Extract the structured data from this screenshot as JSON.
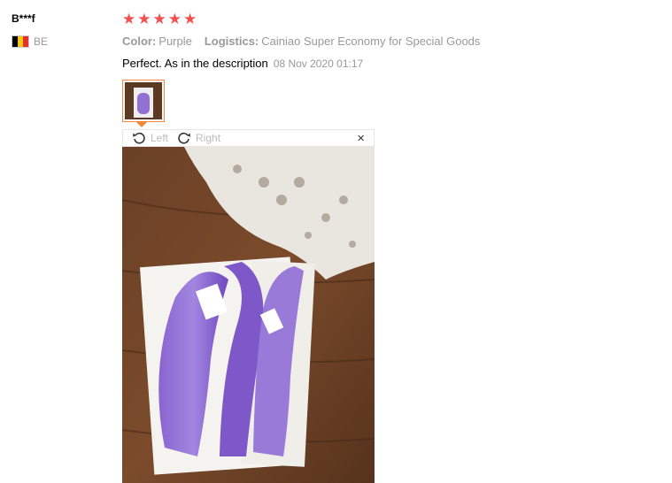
{
  "review": {
    "user": {
      "name": "B***f",
      "country_code": "BE",
      "flag_icon": "belgium-flag-icon",
      "flag_colors": [
        "#000000",
        "#f5c518",
        "#e4312b"
      ]
    },
    "rating": {
      "stars": 5,
      "max": 5,
      "star_color": "#f44e4e"
    },
    "sku": [
      {
        "title": "Color:",
        "value": "Purple"
      },
      {
        "title": "Logistics:",
        "value": "Cainiao Super Economy for Special Goods"
      }
    ],
    "feedback": {
      "text": "Perfect. As in the description",
      "date": "08 Nov 2020 01:17"
    },
    "viewer": {
      "rotate_left": "Left",
      "rotate_right": "Right",
      "close_symbol": "×"
    },
    "colors": {
      "accent": "#f38640",
      "muted": "#999999"
    }
  }
}
